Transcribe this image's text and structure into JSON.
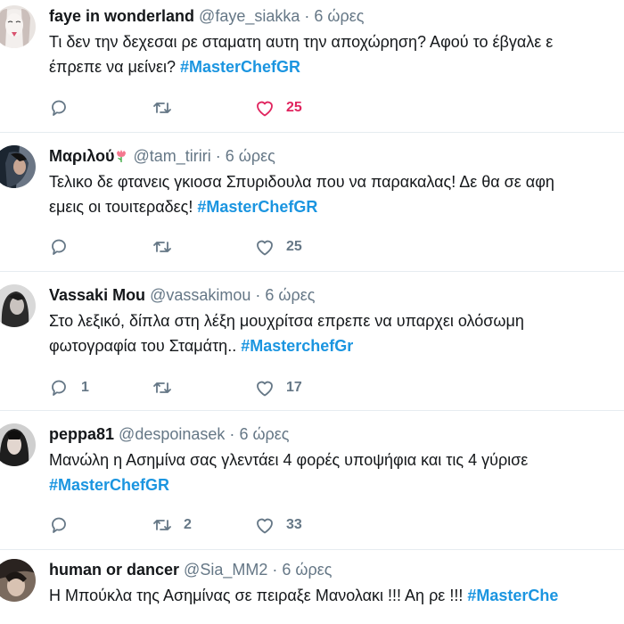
{
  "tweets": [
    {
      "name": "faye in wonderland",
      "handle": "@faye_siakka",
      "separator": "·",
      "time": "6 ώρες",
      "line1": "Τι δεν την δεχεσαι ρε σταματη αυτη την αποχώρηση? Αφού το έβγαλε ε",
      "line2_text": "έπρεπε να μείνει? ",
      "line2_hashtag": "#MasterChefGR",
      "reply_count": "",
      "retweet_count": "",
      "like_count": "25",
      "liked": true
    },
    {
      "name": "Μαριλού",
      "name_emoji": "tulip",
      "handle": "@tam_tiriri",
      "separator": "·",
      "time": "6 ώρες",
      "line1": "Τελικο δε φτανεις γκιοσα Σπυριδουλα που να παρακαλας! Δε θα σε αφη",
      "line2_text": "εμεις οι τουιτεραδες! ",
      "line2_hashtag": "#MasterChefGR",
      "reply_count": "",
      "retweet_count": "",
      "like_count": "25",
      "liked": false
    },
    {
      "name": "Vassaki Mou",
      "handle": "@vassakimou",
      "separator": "·",
      "time": "6 ώρες",
      "line1": "Στο λεξικό, δίπλα στη λέξη μουχρίτσα επρεπε να υπαρχει ολόσωμη",
      "line2_text": "φωτογραφία του Σταμάτη.. ",
      "line2_hashtag": "#MasterchefGr",
      "reply_count": "1",
      "retweet_count": "",
      "like_count": "17",
      "liked": false
    },
    {
      "name": "peppa81",
      "handle": "@despoinasek",
      "separator": "·",
      "time": "6 ώρες",
      "line1": "Μανώλη η Ασημίνα σας γλεντάει 4 φορές υποψήφια και τις 4 γύρισε",
      "line2_text": "",
      "line2_hashtag": "#MasterChefGR",
      "reply_count": "",
      "retweet_count": "2",
      "like_count": "33",
      "liked": false
    },
    {
      "name": "human or dancer",
      "handle": "@Sia_MM2",
      "separator": "·",
      "time": "6 ώρες",
      "line1_text": "Η Μπούκλα της Ασημίνας σε πειραξε Μανολακι !!! Αη ρε !!! ",
      "line1_hashtag": "#MasterChe"
    }
  ]
}
